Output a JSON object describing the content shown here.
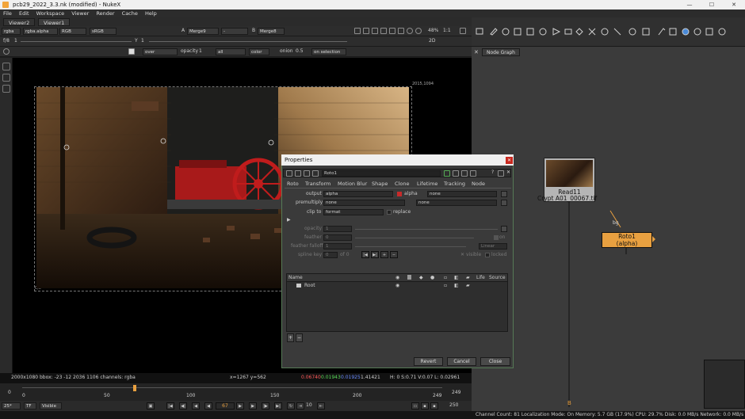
{
  "window": {
    "title": "pcb29_2022_3.3.nk (modified) - NukeX",
    "minimize": "—",
    "maximize": "☐",
    "close": "✕"
  },
  "menu": [
    "File",
    "Edit",
    "Workspace",
    "Viewer",
    "Render",
    "Cache",
    "Help"
  ],
  "viewer_tabs": [
    "Viewer2",
    "Viewer1"
  ],
  "viewer_toolbar": {
    "channels": "rgba",
    "layer": "rgba.alpha",
    "display": "RGB",
    "lut": "sRGB",
    "input_a_label": "A",
    "input_a": "Merge9",
    "wipe": "-",
    "input_b_label": "B",
    "input_b": "Merge8",
    "gain_label": "f/8",
    "gain_value": "1",
    "gamma_label": "Y",
    "gamma_value": "1",
    "zoom": "48%",
    "ratio": "1:1",
    "view_mode": "2D",
    "composite": "over",
    "opacity_label": "opacity",
    "opacity_value": "1",
    "all": "all",
    "color": "color",
    "onion_label": "onion",
    "onion_value": "0.5",
    "on_selection": "on selection"
  },
  "viewer": {
    "format_corner": "2015,1094",
    "origin_label": "0,0"
  },
  "info_bar": {
    "format": "2000x1080",
    "bbox": "bbox: -23 -12 2036 1106 channels: rgba",
    "coords": "x=1267 y=562",
    "r": "0.06740",
    "g": "0.01943",
    "b": "0.01925",
    "a": "1.41421",
    "hsvl": "H: 0 S:0.71 V:0.07  L: 0.02961",
    "colors": {
      "r": "#ff5a5a",
      "g": "#5adc5a",
      "b": "#6a8cff"
    }
  },
  "timeline": {
    "ticks": [
      "0",
      "50",
      "100",
      "150",
      "200",
      "249"
    ],
    "end_label": "249",
    "current_frame": "67",
    "fps": "25*",
    "tf": "TF",
    "visible": "Visible",
    "step": "10",
    "end_frame": "250"
  },
  "status_bar": {
    "text": "Channel Count: 81  Localization Mode: On  Memory: 5.7 GB (17.9%)  CPU: 29.7%  Disk: 0.0 MB/s  Network: 0.0 MB/s"
  },
  "node_graph": {
    "tab": "Node Graph",
    "read_node": {
      "name": "Read11",
      "file": "Crypt A01_00067.tif"
    },
    "roto_node": {
      "name": "Roto1",
      "sub": "(alpha)"
    },
    "pipe_label": "bg",
    "output_label": "B"
  },
  "properties": {
    "title": "Properties",
    "node_name": "Roto1",
    "tabs": [
      "Roto",
      "Transform",
      "Motion Blur",
      "Shape",
      "Clone",
      "Lifetime",
      "Tracking",
      "Node"
    ],
    "output_label": "output",
    "output_value": "alpha",
    "output_check": "alpha",
    "output_extra": "none",
    "premultiply_label": "premultiply",
    "premultiply_value": "none",
    "premultiply_extra": "none",
    "clipto_label": "clip to",
    "clipto_value": "format",
    "replace_label": "replace",
    "opacity_label": "opacity",
    "opacity_value": "1",
    "feather_label": "feather",
    "feather_value": "0",
    "feather_on": "on",
    "feather_falloff_label": "feather falloff",
    "feather_falloff_value": "1",
    "feather_falloff_mode": "Linear",
    "spline_key_label": "spline key",
    "spline_key_value": "0",
    "spline_key_of": "of 0",
    "visible_label": "visible",
    "locked_label": "locked",
    "list_headers": {
      "name": "Name",
      "life": "Life",
      "source": "Source"
    },
    "root_item": "Root",
    "add_btn": "+",
    "remove_btn": "−",
    "revert": "Revert",
    "cancel": "Cancel",
    "close": "Close"
  }
}
